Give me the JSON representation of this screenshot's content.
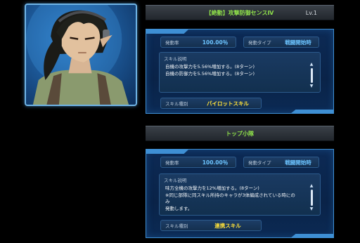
{
  "skill1": {
    "title": "【絶動】攻撃防御センスⅣ",
    "level": "Lv.1",
    "rate_label": "発動率",
    "rate_value": "100.00％",
    "type_label": "発動タイプ",
    "type_value": "戦闘開始時",
    "desc_label": "スキル説明",
    "desc_text": "自機の攻撃力を5.56%増加する。(8ターン)\n自機の防御力を5.56%増加する。(8ターン)",
    "kind_label": "スキル種別",
    "kind_value": "パイロットスキル"
  },
  "skill2": {
    "title": "トップ小隊",
    "rate_label": "発動率",
    "rate_value": "100.00％",
    "type_label": "発動タイプ",
    "type_value": "戦闘開始時",
    "desc_label": "スキル説明",
    "desc_text": "味方全機の攻撃力を12%増加する。(8ターン)\n※同じ部隊に同スキル所持のキャラが3体編成されている時にのみ\n発動します。",
    "kind_label": "スキル種別",
    "kind_value": "連携スキル"
  },
  "colors": {
    "accent": "#3e8fd4",
    "title_green": "#8fe04a",
    "value_blue": "#6cc4ff",
    "value_yellow": "#ffe23a"
  },
  "icons": {
    "scroll_up": "▲",
    "scroll_down": "▼"
  }
}
